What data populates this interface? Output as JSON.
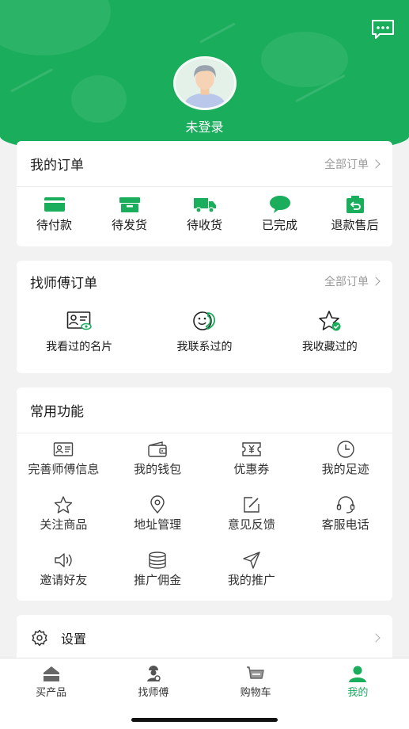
{
  "colors": {
    "brand": "#1aad5c",
    "background": "#f2f2f2"
  },
  "header": {
    "message_icon": "chat-bubble-icon",
    "login_text": "未登录"
  },
  "my_orders": {
    "title": "我的订单",
    "all_label": "全部订单",
    "items": [
      {
        "label": "待付款",
        "icon": "wallet-icon"
      },
      {
        "label": "待发货",
        "icon": "box-icon"
      },
      {
        "label": "待收货",
        "icon": "truck-icon"
      },
      {
        "label": "已完成",
        "icon": "chat-icon"
      },
      {
        "label": "退款售后",
        "icon": "return-icon"
      }
    ]
  },
  "master_orders": {
    "title": "找师傅订单",
    "all_label": "全部订单",
    "items": [
      {
        "label": "我看过的名片",
        "icon": "card-eye-icon"
      },
      {
        "label": "我联系过的",
        "icon": "phone-face-icon"
      },
      {
        "label": "我收藏过的",
        "icon": "star-check-icon"
      }
    ]
  },
  "functions": {
    "title": "常用功能",
    "items": [
      {
        "label": "完善师傅信息",
        "icon": "id-card-icon"
      },
      {
        "label": "我的钱包",
        "icon": "wallet-icon"
      },
      {
        "label": "优惠券",
        "icon": "coupon-icon"
      },
      {
        "label": "我的足迹",
        "icon": "clock-icon"
      },
      {
        "label": "关注商品",
        "icon": "star-icon"
      },
      {
        "label": "地址管理",
        "icon": "location-icon"
      },
      {
        "label": "意见反馈",
        "icon": "edit-icon"
      },
      {
        "label": "客服电话",
        "icon": "headset-icon"
      },
      {
        "label": "邀请好友",
        "icon": "speaker-icon"
      },
      {
        "label": "推广佣金",
        "icon": "coins-icon"
      },
      {
        "label": "我的推广",
        "icon": "send-icon"
      }
    ]
  },
  "settings": {
    "label": "设置",
    "icon": "gear-icon"
  },
  "tabbar": {
    "items": [
      {
        "label": "买产品",
        "icon": "shop-icon",
        "active": false
      },
      {
        "label": "找师傅",
        "icon": "worker-icon",
        "active": false
      },
      {
        "label": "购物车",
        "icon": "cart-icon",
        "active": false
      },
      {
        "label": "我的",
        "icon": "user-icon",
        "active": true
      }
    ]
  }
}
